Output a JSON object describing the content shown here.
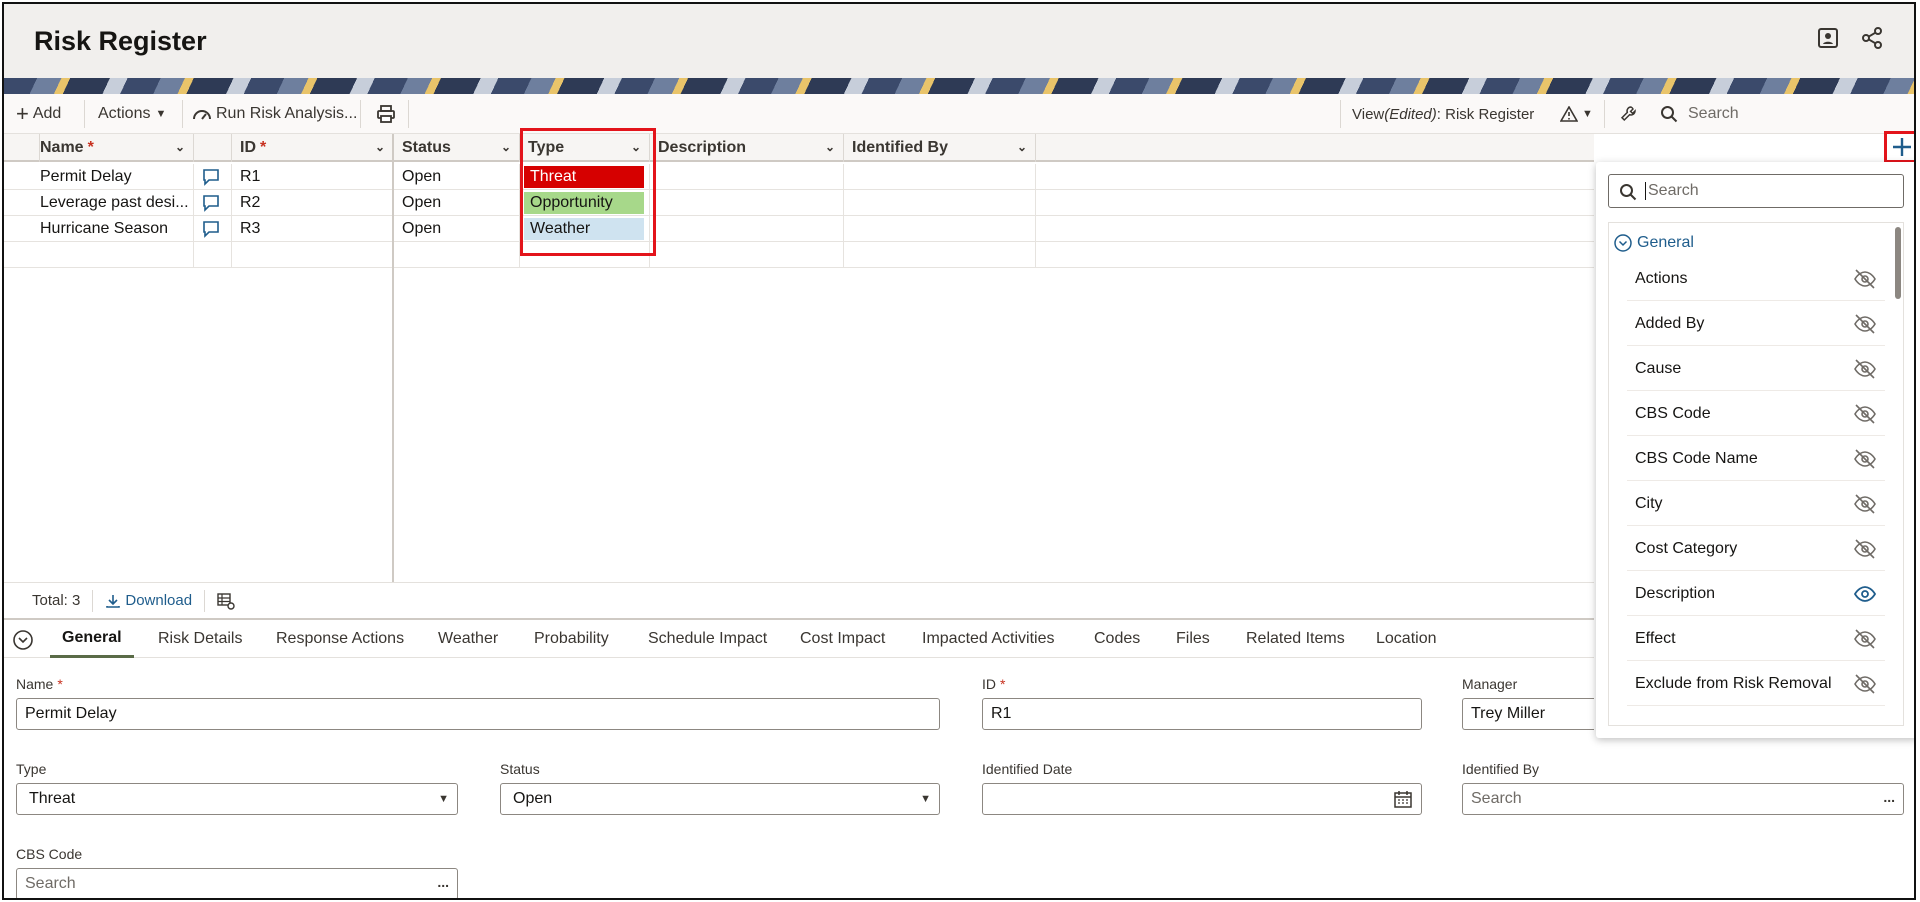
{
  "header": {
    "title": "Risk Register"
  },
  "toolbar": {
    "add_label": "Add",
    "actions_label": "Actions",
    "run_label": "Run Risk Analysis...",
    "view_prefix": "View ",
    "view_edited": "(Edited)",
    "view_suffix": ": Risk Register",
    "search_placeholder": "Search"
  },
  "grid": {
    "columns": {
      "name": "Name",
      "id": "ID",
      "status": "Status",
      "type": "Type",
      "description": "Description",
      "identified_by": "Identified By"
    },
    "rows": [
      {
        "name": "Permit Delay",
        "id": "R1",
        "status": "Open",
        "type": "Threat"
      },
      {
        "name": "Leverage past desi...",
        "id": "R2",
        "status": "Open",
        "type": "Opportunity"
      },
      {
        "name": "Hurricane Season",
        "id": "R3",
        "status": "Open",
        "type": "Weather"
      }
    ]
  },
  "footer": {
    "total": "Total: 3",
    "download": "Download"
  },
  "tabs": [
    "General",
    "Risk Details",
    "Response Actions",
    "Weather",
    "Probability",
    "Schedule Impact",
    "Cost Impact",
    "Impacted Activities",
    "Codes",
    "Files",
    "Related Items",
    "Location"
  ],
  "form": {
    "name_label": "Name",
    "name_value": "Permit Delay",
    "id_label": "ID",
    "id_value": "R1",
    "manager_label": "Manager",
    "manager_value": "Trey Miller",
    "type_label": "Type",
    "type_value": "Threat",
    "status_label": "Status",
    "status_value": "Open",
    "identified_date_label": "Identified Date",
    "identified_by_label": "Identified By",
    "identified_by_placeholder": "Search",
    "cbs_label": "CBS Code",
    "cbs_placeholder": "Search"
  },
  "panel": {
    "search_placeholder": "Search",
    "group": "General",
    "items": [
      {
        "label": "Actions",
        "visible": false
      },
      {
        "label": "Added By",
        "visible": false
      },
      {
        "label": "Cause",
        "visible": false
      },
      {
        "label": "CBS Code",
        "visible": false
      },
      {
        "label": "CBS Code Name",
        "visible": false
      },
      {
        "label": "City",
        "visible": false
      },
      {
        "label": "Cost Category",
        "visible": false
      },
      {
        "label": "Description",
        "visible": true
      },
      {
        "label": "Effect",
        "visible": false
      },
      {
        "label": "Exclude from Risk Removal",
        "visible": false
      }
    ]
  },
  "colors": {
    "threat": "#d60000",
    "opportunity": "#a7d88a",
    "weather": "#cfe3f0",
    "highlight": "#e3141b",
    "required": "#c7301f"
  }
}
